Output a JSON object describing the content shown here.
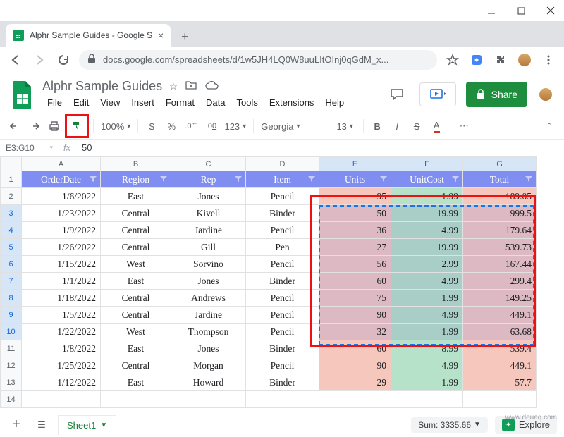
{
  "window": {
    "tab_title": "Alphr Sample Guides - Google S"
  },
  "address": {
    "url": "docs.google.com/spreadsheets/d/1w5JH4LQ0W8uuLItOInj0qGdM_x..."
  },
  "doc": {
    "title": "Alphr Sample Guides",
    "menu": [
      "File",
      "Edit",
      "View",
      "Insert",
      "Format",
      "Data",
      "Tools",
      "Extensions",
      "Help"
    ]
  },
  "share": {
    "label": "Share"
  },
  "toolbar": {
    "zoom": "100%",
    "currency": "$",
    "percent": "%",
    "dec_dec": ".0",
    "dec_inc": ".00",
    "numfmt": "123",
    "font": "Georgia",
    "fontsize": "13",
    "bold": "B",
    "italic": "I",
    "strike": "S",
    "textcolor": "A"
  },
  "namebox": {
    "ref": "E3:G10",
    "fx": "fx",
    "value": "50"
  },
  "columns": [
    "A",
    "B",
    "C",
    "D",
    "E",
    "F",
    "G"
  ],
  "headers": {
    "a": "OrderDate",
    "b": "Region",
    "c": "Rep",
    "d": "Item",
    "e": "Units",
    "f": "UnitCost",
    "g": "Total"
  },
  "rows": [
    {
      "n": "2",
      "a": "1/6/2022",
      "b": "East",
      "c": "Jones",
      "d": "Pencil",
      "e": "95",
      "f": "1.99",
      "g": "189.05"
    },
    {
      "n": "3",
      "a": "1/23/2022",
      "b": "Central",
      "c": "Kivell",
      "d": "Binder",
      "e": "50",
      "f": "19.99",
      "g": "999.5"
    },
    {
      "n": "4",
      "a": "1/9/2022",
      "b": "Central",
      "c": "Jardine",
      "d": "Pencil",
      "e": "36",
      "f": "4.99",
      "g": "179.64"
    },
    {
      "n": "5",
      "a": "1/26/2022",
      "b": "Central",
      "c": "Gill",
      "d": "Pen",
      "e": "27",
      "f": "19.99",
      "g": "539.73"
    },
    {
      "n": "6",
      "a": "1/15/2022",
      "b": "West",
      "c": "Sorvino",
      "d": "Pencil",
      "e": "56",
      "f": "2.99",
      "g": "167.44"
    },
    {
      "n": "7",
      "a": "1/1/2022",
      "b": "East",
      "c": "Jones",
      "d": "Binder",
      "e": "60",
      "f": "4.99",
      "g": "299.4"
    },
    {
      "n": "8",
      "a": "1/18/2022",
      "b": "Central",
      "c": "Andrews",
      "d": "Pencil",
      "e": "75",
      "f": "1.99",
      "g": "149.25"
    },
    {
      "n": "9",
      "a": "1/5/2022",
      "b": "Central",
      "c": "Jardine",
      "d": "Pencil",
      "e": "90",
      "f": "4.99",
      "g": "449.1"
    },
    {
      "n": "10",
      "a": "1/22/2022",
      "b": "West",
      "c": "Thompson",
      "d": "Pencil",
      "e": "32",
      "f": "1.99",
      "g": "63.68"
    },
    {
      "n": "11",
      "a": "1/8/2022",
      "b": "East",
      "c": "Jones",
      "d": "Binder",
      "e": "60",
      "f": "8.99",
      "g": "539.4"
    },
    {
      "n": "12",
      "a": "1/25/2022",
      "b": "Central",
      "c": "Morgan",
      "d": "Pencil",
      "e": "90",
      "f": "4.99",
      "g": "449.1"
    },
    {
      "n": "13",
      "a": "1/12/2022",
      "b": "East",
      "c": "Howard",
      "d": "Binder",
      "e": "29",
      "f": "1.99",
      "g": "57.7"
    }
  ],
  "bottom": {
    "sheet": "Sheet1",
    "sum": "Sum: 3335.66",
    "explore": "Explore"
  },
  "watermark": "www.deuaq.com"
}
